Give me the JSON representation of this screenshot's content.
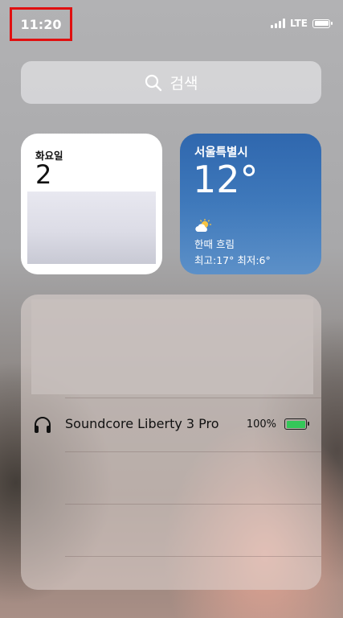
{
  "status_bar": {
    "time": "11:20",
    "network": "LTE",
    "signal_bars": 4
  },
  "search": {
    "label": "검색",
    "icon": "search-icon"
  },
  "calendar_widget": {
    "weekday": "화요일",
    "day": "2"
  },
  "weather_widget": {
    "city": "서울특별시",
    "temperature": "12°",
    "condition": "한때 흐림",
    "range": "최고:17° 최저:6°",
    "icon": "partly-cloudy-icon"
  },
  "batteries_widget": {
    "devices": [
      {
        "name": "Soundcore Liberty 3 Pro",
        "percent": "100%",
        "level": 1.0,
        "icon": "headphones-icon"
      }
    ],
    "colors": {
      "battery_fill": "#34c759"
    }
  }
}
